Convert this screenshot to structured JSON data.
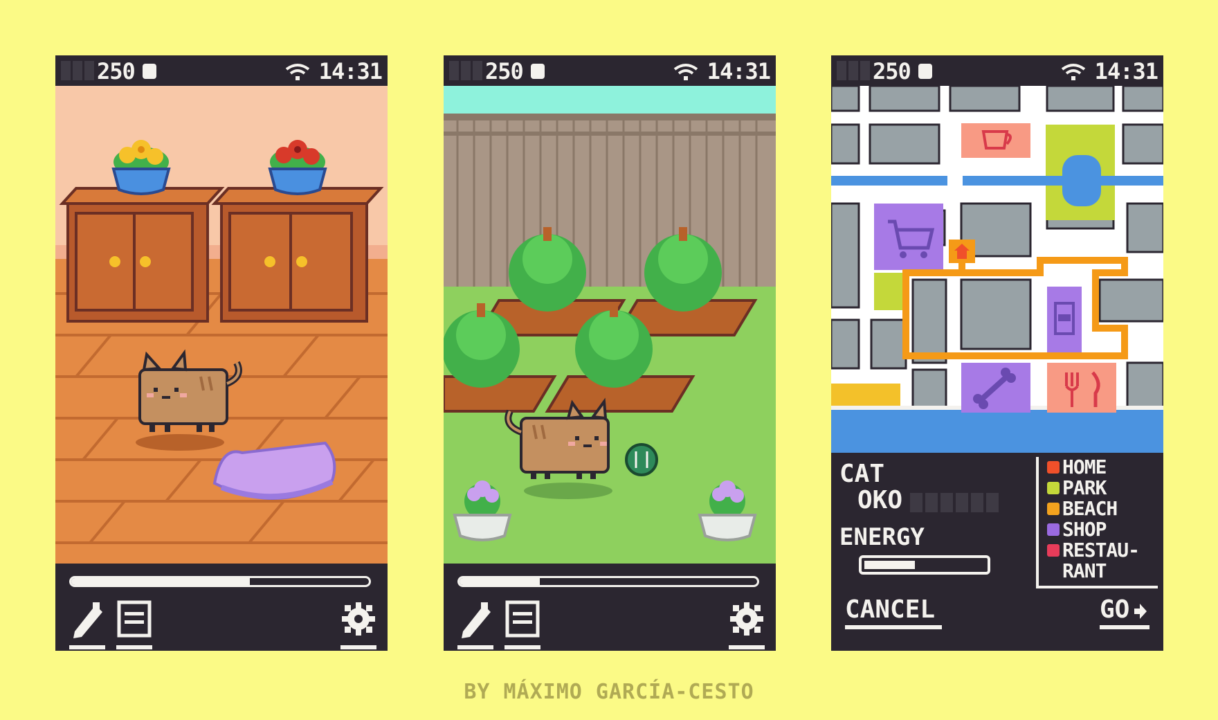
{
  "status_bar": {
    "coins": "250",
    "time": "14:31",
    "signal_icon": "wifi-icon",
    "coin_icon": "coin-icon"
  },
  "screens": [
    {
      "name": "room",
      "progress": 0.6
    },
    {
      "name": "garden",
      "progress": 0.27
    },
    {
      "name": "map",
      "progress": null
    }
  ],
  "toolbar": {
    "edit_icon": "pencil-icon",
    "list_icon": "list-icon",
    "settings_icon": "gear-icon"
  },
  "map_panel": {
    "cat_label": "CAT",
    "cat_name": "OKO",
    "energy_label": "ENERGY",
    "energy_level": 0.4,
    "legend": [
      {
        "label": "HOME",
        "color": "#f0502a"
      },
      {
        "label": "PARK",
        "color": "#c4d83a"
      },
      {
        "label": "BEACH",
        "color": "#f3a21e"
      },
      {
        "label": "SHOP",
        "color": "#9a6ae0"
      },
      {
        "label": "RESTAU-",
        "color": "#e83c5a"
      },
      {
        "label": "RANT",
        "color": ""
      }
    ],
    "cancel_label": "CANCEL",
    "go_label": "GO"
  },
  "credit": "BY MÁXIMO GARCÍA-CESTO",
  "colors": {
    "background": "#fbfa86",
    "ui_dark": "#2b2630",
    "ui_light": "#f4f2ee",
    "route": "#f59a17",
    "water": "#4b93e0"
  }
}
